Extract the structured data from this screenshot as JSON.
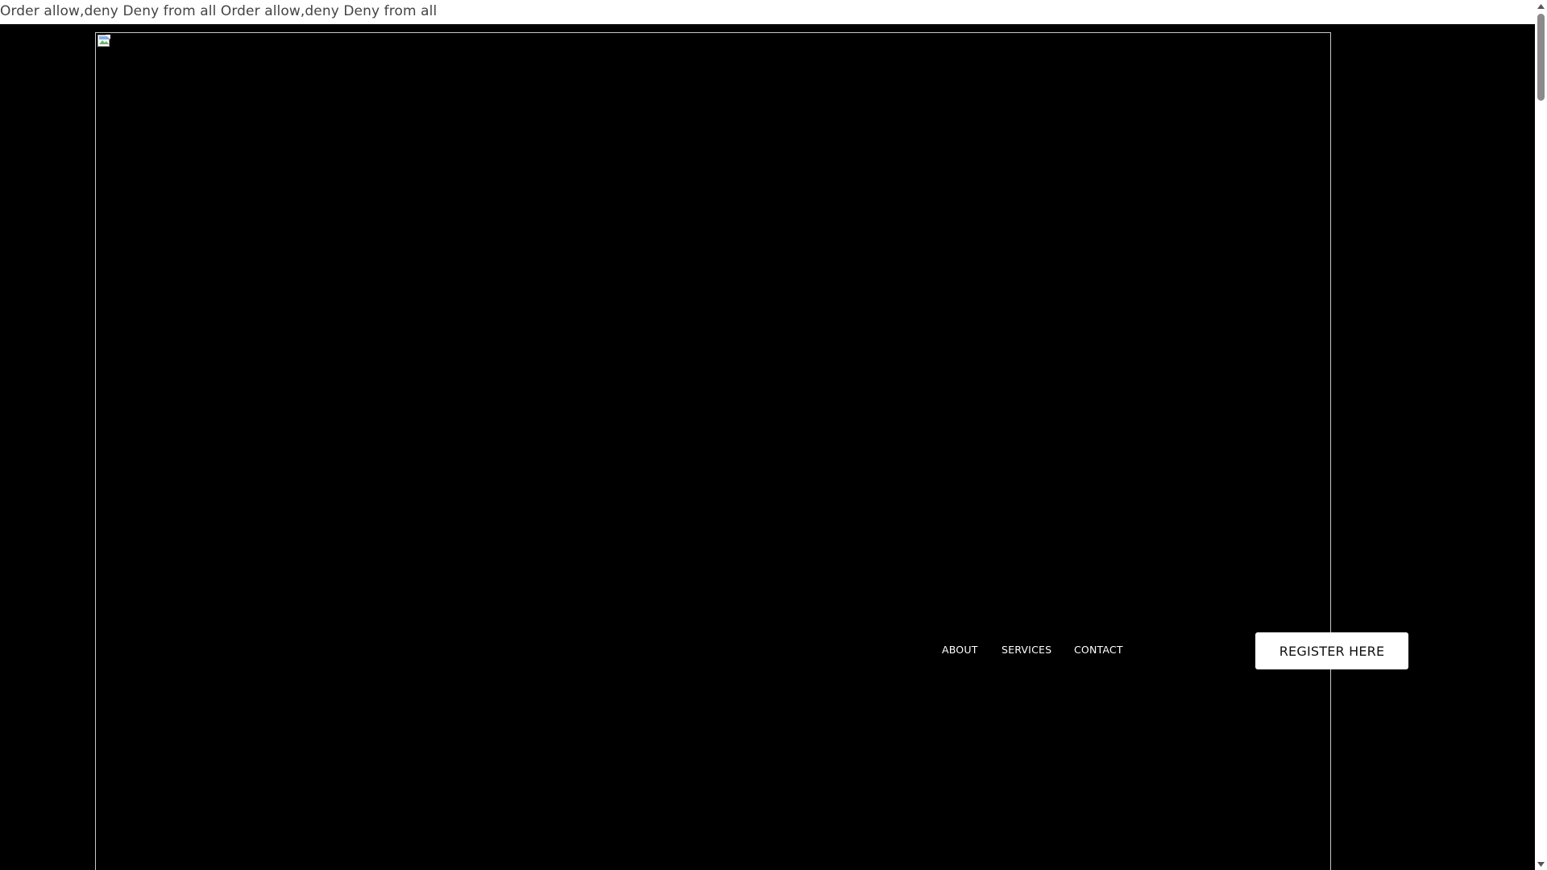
{
  "header": {
    "error_text": "Order allow,deny Deny from all Order allow,deny Deny from all"
  },
  "hero": {
    "image_icon": "broken-image-icon"
  },
  "nav": {
    "items": [
      {
        "label": "ABOUT"
      },
      {
        "label": "SERVICES"
      },
      {
        "label": "CONTACT"
      }
    ]
  },
  "cta": {
    "register_label": "REGISTER HERE"
  },
  "colors": {
    "background": "#000000",
    "button_bg": "#ffffff",
    "nav_text": "#ffffff"
  }
}
